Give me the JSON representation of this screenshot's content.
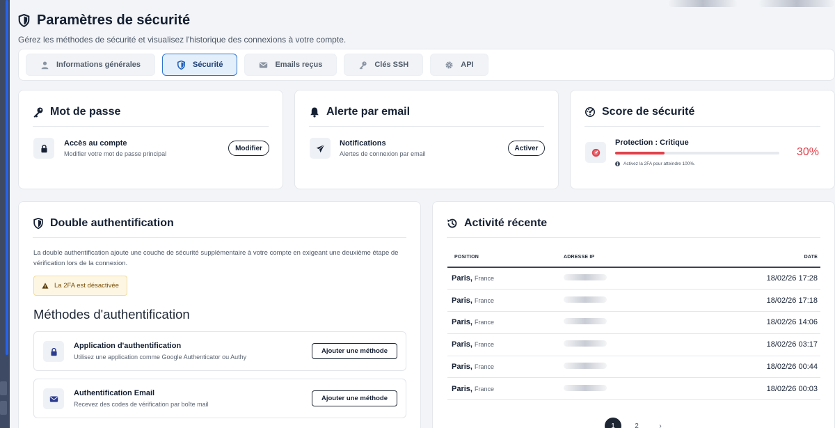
{
  "header": {
    "title": "Paramètres de sécurité",
    "subtitle": "Gérez les méthodes de sécurité et visualisez l'historique des connexions à votre compte."
  },
  "tabs": [
    {
      "label": "Informations générales",
      "icon": "user-icon",
      "active": false
    },
    {
      "label": "Sécurité",
      "icon": "shield-icon",
      "active": true
    },
    {
      "label": "Emails reçus",
      "icon": "envelope-icon",
      "active": false
    },
    {
      "label": "Clés SSH",
      "icon": "key-icon",
      "active": false
    },
    {
      "label": "API",
      "icon": "gear-icon",
      "active": false
    }
  ],
  "password_card": {
    "title": "Mot de passe",
    "item_title": "Accès au compte",
    "item_sub": "Modifier votre mot de passe principal",
    "button": "Modifier"
  },
  "email_alert_card": {
    "title": "Alerte par email",
    "item_title": "Notifications",
    "item_sub": "Alertes de connexion par email",
    "button": "Activer"
  },
  "score_card": {
    "title": "Score de sécurité",
    "label": "Protection : Critique",
    "percent_text": "30%",
    "progress": 0.3,
    "hint": "Activez la 2FA pour atteindre 100%.",
    "color": "#e0414b"
  },
  "twofa_card": {
    "title": "Double authentification",
    "description": "La double authentification ajoute une couche de sécurité supplémentaire à votre compte en exigeant une deuxième étape de vérification lors de la connexion.",
    "warning": "La 2FA est désactivée",
    "methods_title": "Méthodes d'authentification",
    "methods": [
      {
        "title": "Application d'authentification",
        "sub": "Utilisez une application comme Google Authenticator ou Authy",
        "button": "Ajouter une méthode",
        "icon": "lock-icon"
      },
      {
        "title": "Authentification Email",
        "sub": "Recevez des codes de vérification par boîte mail",
        "button": "Ajouter une méthode",
        "icon": "envelope-icon"
      }
    ]
  },
  "activity_card": {
    "title": "Activité récente",
    "columns": [
      "POSITION",
      "ADRESSE IP",
      "DATE"
    ],
    "rows": [
      {
        "city": "Paris,",
        "country": "France",
        "date": "18/02/26 17:28"
      },
      {
        "city": "Paris,",
        "country": "France",
        "date": "18/02/26 17:18"
      },
      {
        "city": "Paris,",
        "country": "France",
        "date": "18/02/26 14:06"
      },
      {
        "city": "Paris,",
        "country": "France",
        "date": "18/02/26 03:17"
      },
      {
        "city": "Paris,",
        "country": "France",
        "date": "18/02/26 00:44"
      },
      {
        "city": "Paris,",
        "country": "France",
        "date": "18/02/26 00:03"
      }
    ],
    "pagination": {
      "pages": [
        "1",
        "2"
      ],
      "current": "1",
      "next": "›"
    }
  }
}
